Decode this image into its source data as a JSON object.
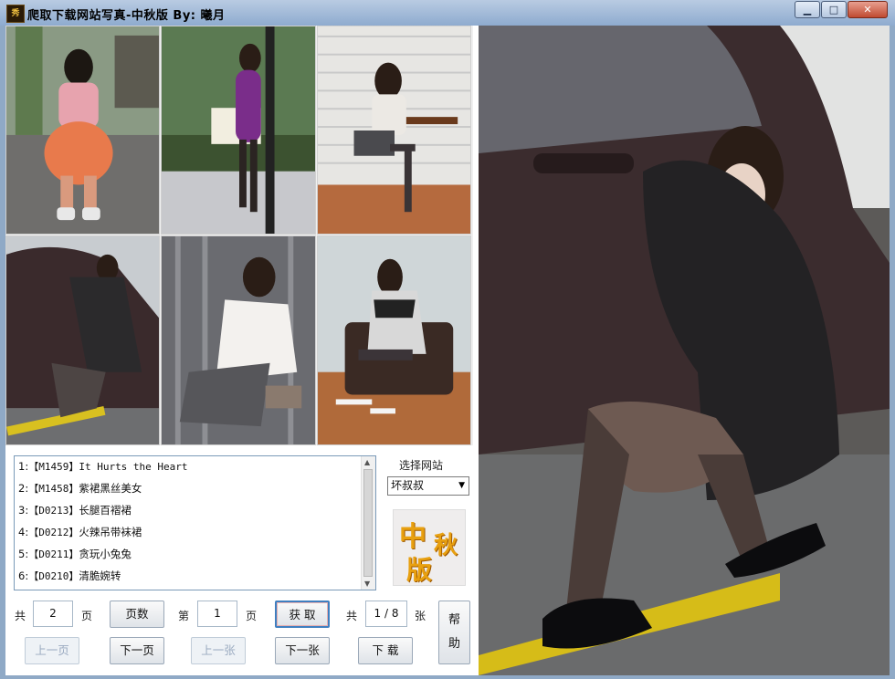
{
  "window": {
    "app_icon_text": "秀",
    "title": "爬取下载网站写真-中秋版    By: 曦月",
    "minimize_label": "▁",
    "maximize_label": "□",
    "close_label": "✕"
  },
  "photos": {
    "thumbnail_count": 6,
    "has_preview": true
  },
  "album_list": {
    "items": [
      {
        "index": "1:",
        "code": "【M1459】",
        "name": "It Hurts the Heart"
      },
      {
        "index": "2:",
        "code": "【M1458】",
        "name": "紫裙黑丝美女"
      },
      {
        "index": "3:",
        "code": "【D0213】",
        "name": "长腿百褶裙"
      },
      {
        "index": "4:",
        "code": "【D0212】",
        "name": "火辣吊带袜裙"
      },
      {
        "index": "5:",
        "code": "【D0211】",
        "name": "贪玩小兔兔"
      },
      {
        "index": "6:",
        "code": "【D0210】",
        "name": "清脆婉转"
      }
    ]
  },
  "site": {
    "label": "选择网站",
    "selected": "坏叔叔",
    "logo_chars": [
      "中",
      "秋",
      "版"
    ]
  },
  "paging": {
    "total_prefix": "共",
    "total_pages": "2",
    "page_unit": "页",
    "page_count_button": "页数",
    "current_prefix": "第",
    "current_page": "1",
    "current_unit": "页",
    "fetch_button": "获 取",
    "image_prefix": "共",
    "image_counter": "1 / 8",
    "image_unit": "张",
    "prev_page": "上一页",
    "next_page": "下一页",
    "prev_image": "上一张",
    "next_image": "下一张",
    "download": "下 载",
    "help_chars": [
      "帮",
      "助"
    ]
  },
  "colors": {
    "titlebar": "#a6bddb",
    "logo_gold": "#e8a010",
    "focus_border": "#3f7fc0"
  }
}
